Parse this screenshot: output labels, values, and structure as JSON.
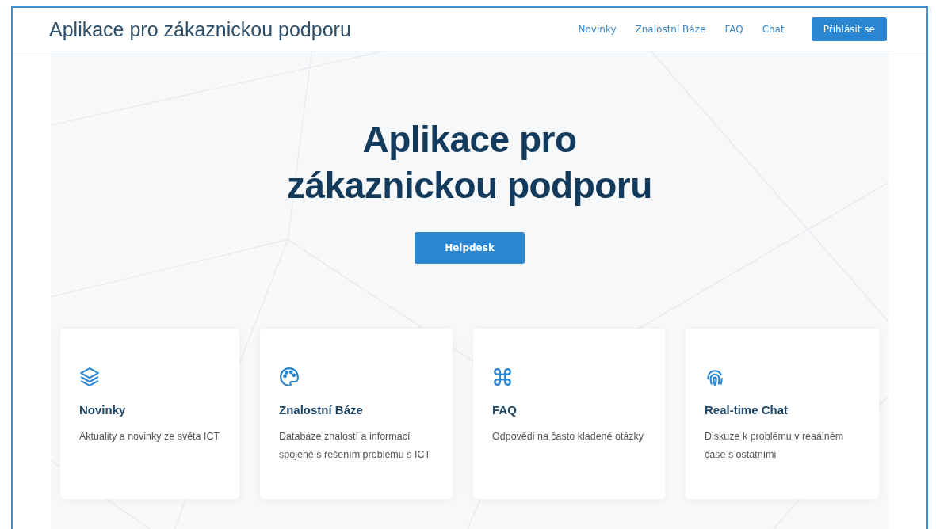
{
  "header": {
    "brand": "Aplikace pro zákaznickou podporu",
    "nav": [
      {
        "label": "Novinky"
      },
      {
        "label": "Znalostní Báze"
      },
      {
        "label": "FAQ"
      },
      {
        "label": "Chat"
      }
    ],
    "login_button": "Přihlásit se"
  },
  "hero": {
    "title_lines": [
      "Aplikace pro",
      "zákaznickou podporu"
    ],
    "button": "Helpdesk"
  },
  "features": [
    {
      "kind": "layers",
      "title": "Novinky",
      "text": "Aktuality a novinky ze světa ICT"
    },
    {
      "kind": "palette",
      "title": "Znalostní Báze",
      "text": "Databáze znalostí a informací spojené s řešením problému s ICT"
    },
    {
      "kind": "command",
      "title": "FAQ",
      "text": "Odpovědi na často kladené otázky"
    },
    {
      "kind": "fingerprint",
      "title": "Real-time Chat",
      "text": "Diskuze k problému v reaálném čase s ostatními"
    }
  ]
}
